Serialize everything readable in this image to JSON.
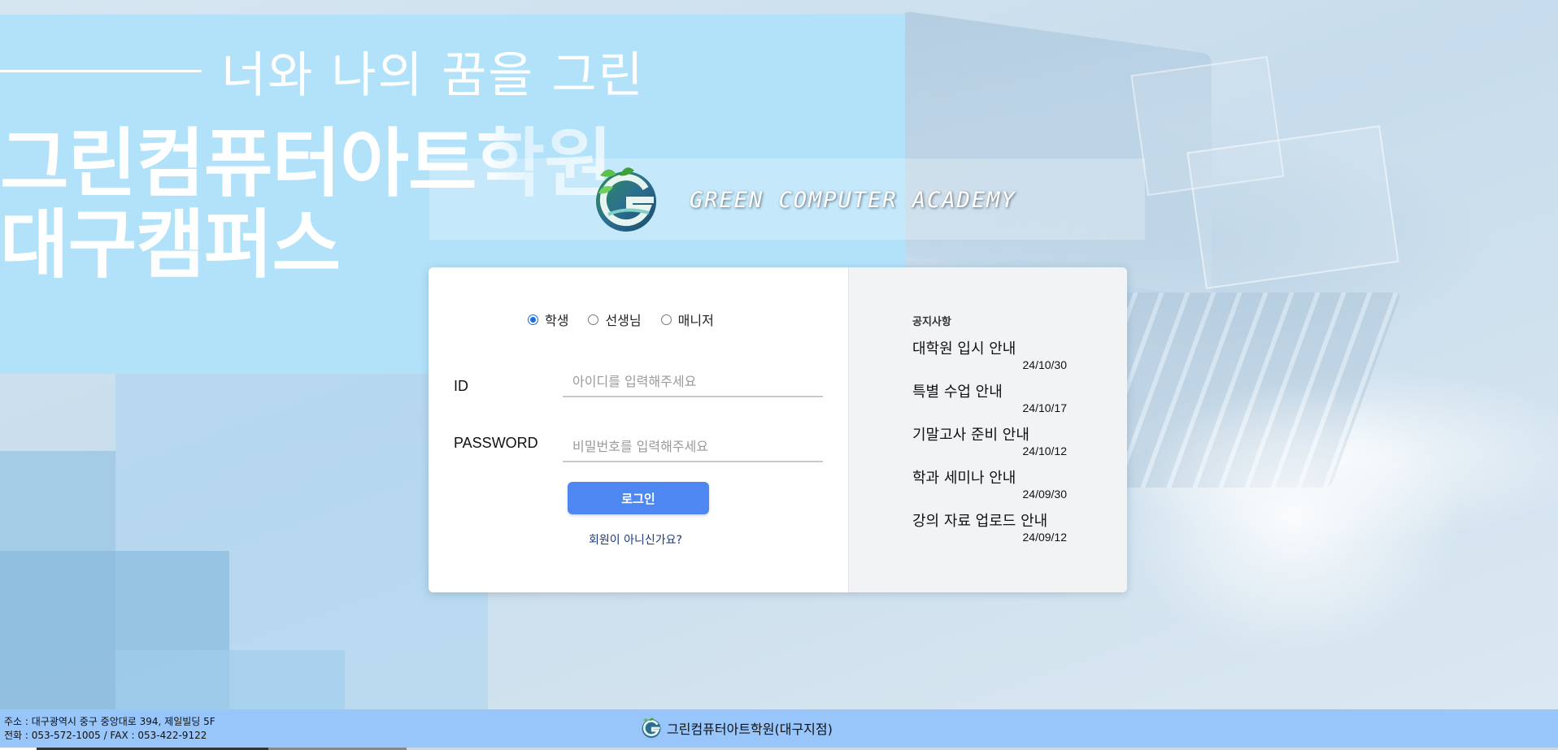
{
  "hero": {
    "tagline": "너와 나의 꿈을 그린",
    "title_line1": "그린컴퓨터아트학원",
    "title_line2": "대구캠퍼스"
  },
  "logo": {
    "text": "GREEN COMPUTER ACADEMY",
    "icon": "green-g-logo-icon"
  },
  "login": {
    "roles": [
      {
        "label": "학생",
        "checked": true
      },
      {
        "label": "선생님",
        "checked": false
      },
      {
        "label": "매니저",
        "checked": false
      }
    ],
    "id_label": "ID",
    "id_placeholder": "아이디를 입력해주세요",
    "password_label": "PASSWORD",
    "password_placeholder": "비밀번호를 입력해주세요",
    "login_button": "로그인",
    "signup_link": "회원이 아니신가요?"
  },
  "notices": {
    "title": "공지사항",
    "items": [
      {
        "title": "대학원 입시 안내",
        "date": "24/10/30"
      },
      {
        "title": "특별 수업 안내",
        "date": "24/10/17"
      },
      {
        "title": "기말고사 준비 안내",
        "date": "24/10/12"
      },
      {
        "title": "학과 세미나 안내",
        "date": "24/09/30"
      },
      {
        "title": "강의 자료 업로드 안내",
        "date": "24/09/12"
      }
    ]
  },
  "footer": {
    "address": "주소 : 대구광역시 중구 중앙대로 394, 제일빌딩 5F",
    "phone": "전화 : 053-572-1005 / FAX : 053-422-9122",
    "brand": "그린컴퓨터아트학원(대구지점)"
  },
  "colors": {
    "hero_block": "#b2e1fa",
    "login_button": "#4e86f2",
    "footer": "#98c5fa",
    "logo_green": "#3aa640"
  }
}
